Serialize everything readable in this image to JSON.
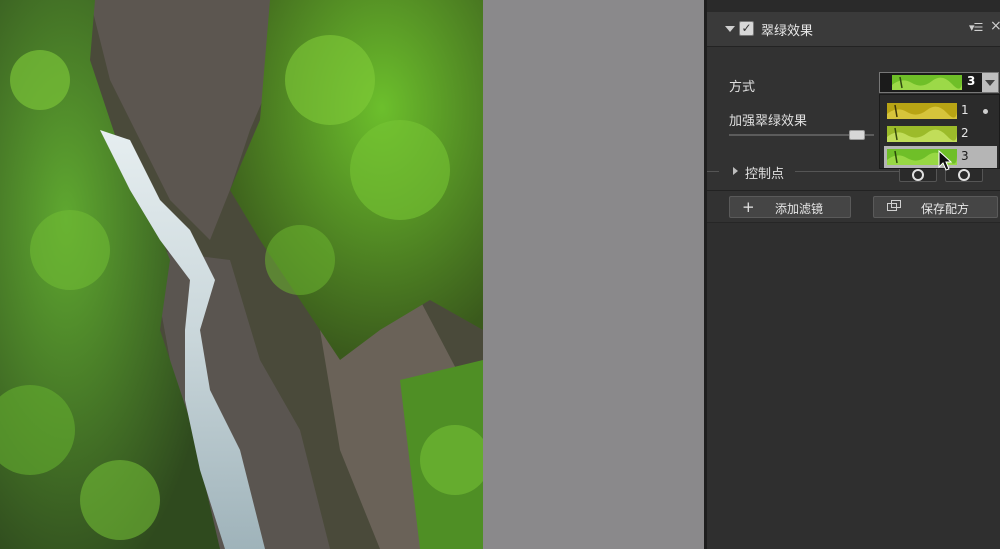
{
  "filter_panel": {
    "title": "翠绿效果",
    "enabled_check": "✓",
    "menu_icon": "menu-icon",
    "close_icon": "×",
    "method_label": "方式",
    "method_selected_value": "3",
    "enhance_label": "加强翠绿效果",
    "enhance_level": 0.88,
    "controls_label": "控制点",
    "options": [
      {
        "label": "1",
        "swatch": "#b8a414"
      },
      {
        "label": "2",
        "swatch": "#9cbb2a"
      },
      {
        "label": "3",
        "swatch": "#6fbf28"
      }
    ]
  },
  "buttons": {
    "add_icon": "+",
    "add_filter": "添加滤镜",
    "save_recipe": "保存配方"
  },
  "colors": {
    "panel_bg": "#323232",
    "workspace_bg": "#8a898b",
    "accent_green": "#7ecb2c"
  }
}
